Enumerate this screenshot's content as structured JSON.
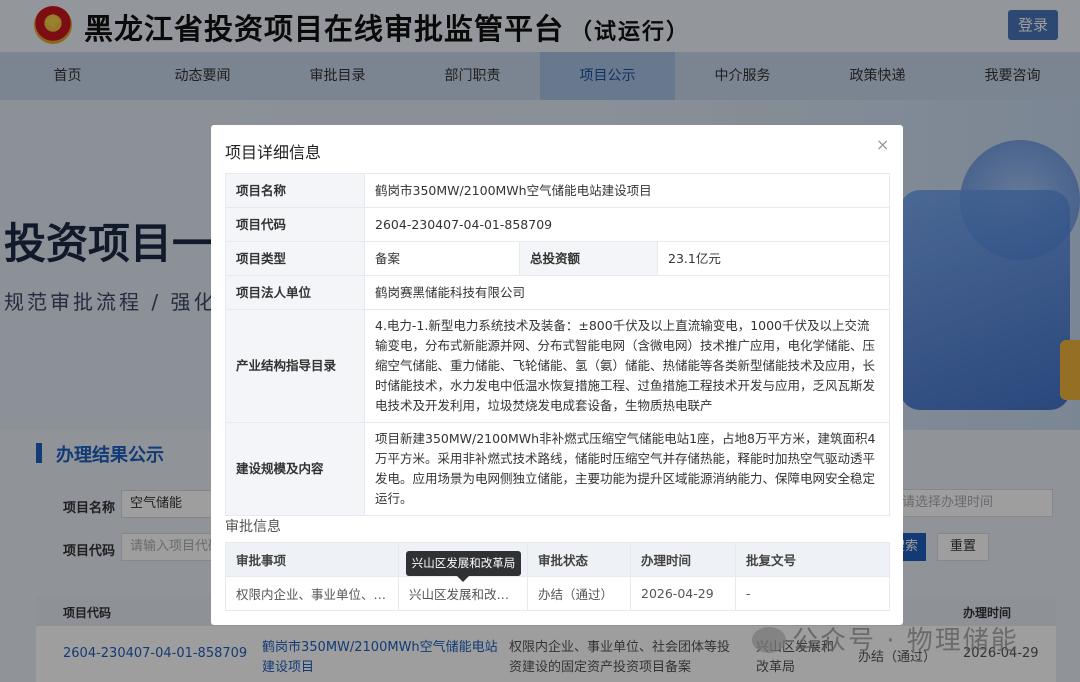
{
  "header": {
    "title": "黑龙江省投资项目在线审批监管平台",
    "title_suffix": "（试运行）",
    "login_label": "登录"
  },
  "nav": [
    "首页",
    "动态要闻",
    "审批目录",
    "部门职责",
    "项目公示",
    "中介服务",
    "政策快递",
    "我要咨询"
  ],
  "nav_active": "项目公示",
  "banner": {
    "title": "投资项目一",
    "subtitle": "规范审批流程 / 强化"
  },
  "results": {
    "section_title": "办理结果公示",
    "project_name_label": "项目名称",
    "project_name_value": "空气储能",
    "project_code_label": "项目代码",
    "project_code_placeholder": "请输入项目代码",
    "date_placeholder": "请选择办理时间",
    "search_label": "搜索",
    "reset_label": "重置",
    "columns": [
      "项目代码",
      "办理时间"
    ],
    "row": {
      "code": "2604-230407-04-01-858709",
      "name_line1": "鹤岗市350MW/2100MWh空气储能电站",
      "name_line2": "建设项目",
      "item_line1": "权限内企业、事业单位、社会团体等投",
      "item_line2": "资建设的固定资产投资项目备案",
      "dept_line1": "兴山区发展和",
      "dept_line2": "改革局",
      "status": "办结（通过）",
      "date": "2026-04-29"
    }
  },
  "modal": {
    "title": "项目详细信息",
    "close": "×",
    "fields": {
      "name_label": "项目名称",
      "name": "鹤岗市350MW/2100MWh空气储能电站建设项目",
      "code_label": "项目代码",
      "code": "2604-230407-04-01-858709",
      "type_label": "项目类型",
      "type": "备案",
      "investment_label": "总投资额",
      "investment": "23.1亿元",
      "entity_label": "项目法人单位",
      "entity": "鹤岗赛黑储能科技有限公司",
      "catalog_label": "产业结构指导目录",
      "catalog": "4.电力-1.新型电力系统技术及装备：±800千伏及以上直流输变电，1000千伏及以上交流输变电，分布式新能源并网、分布式智能电网（含微电网）技术推广应用，电化学储能、压缩空气储能、重力储能、飞轮储能、氢（氨）储能、热储能等各类新型储能技术及应用，长时储能技术，水力发电中低温水恢复措施工程、过鱼措施工程技术开发与应用，乏风瓦斯发电技术及开发利用，垃圾焚烧发电成套设备，生物质热电联产",
      "scope_label": "建设规模及内容",
      "scope": "项目新建350MW/2100MWh非补燃式压缩空气储能电站1座，占地8万平方米，建筑面积4万平方米。采用非补燃式技术路线，储能时压缩空气并存储热能，释能时加热空气驱动透平发电。应用场景为电网侧独立储能，主要功能为提升区域能源消纳能力、保障电网安全稳定运行。"
    },
    "approval": {
      "section_title": "审批信息",
      "headers": [
        "审批事项",
        "审批部门",
        "审批状态",
        "办理时间",
        "批复文号"
      ],
      "row": [
        "权限内企业、事业单位、…",
        "兴山区发展和改…",
        "办结（通过）",
        "2026-04-29",
        "-"
      ],
      "tooltip": "兴山区发展和改革局"
    }
  },
  "watermark": "公众号 · 物理储能"
}
